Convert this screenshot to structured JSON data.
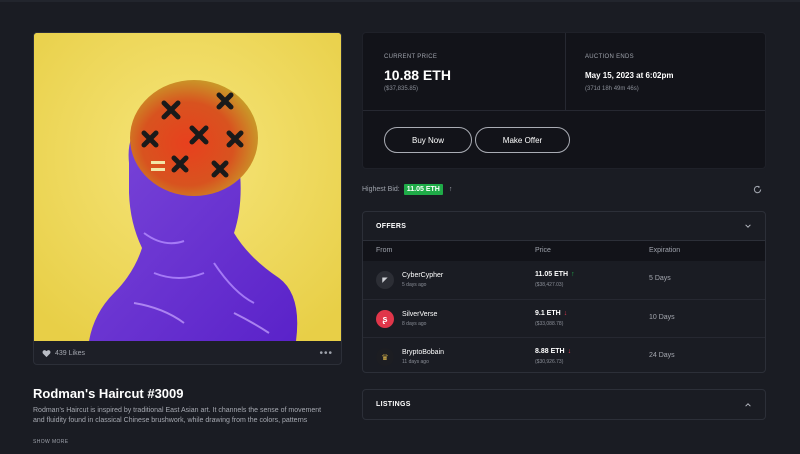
{
  "nft": {
    "likes": "439 Likes",
    "title": "Rodman's Haircut #3009",
    "description": "Rodman's Haircut is inspired by traditional East Asian art. It channels the sense of movement and fluidity found in classical Chinese brushwork, while drawing from the colors, patterns",
    "show_more": "SHOW MORE"
  },
  "price_panel": {
    "current_price_label": "CURRENT PRICE",
    "current_price": "10.88 ETH",
    "current_price_usd": "($37,835.85)",
    "auction_label": "AUCTION ENDS",
    "auction_date": "May 15, 2023 at 6:02pm",
    "auction_remaining": "(371d 18h 49m 46s)",
    "buy_label": "Buy Now",
    "offer_label": "Make Offer"
  },
  "highest_bid": {
    "label": "Highest Bid:",
    "value": "11.05 ETH",
    "arrow": "↑"
  },
  "offers": {
    "title": "OFFERS",
    "columns": [
      "From",
      "Price",
      "Expiration"
    ],
    "rows": [
      {
        "name": "CyberCypher",
        "time": "5 days ago",
        "price": "11.05 ETH",
        "arrow": "↑",
        "arrow_color": "#1fab48",
        "usd": "($38,427.03)",
        "expiration": "5 Days",
        "avatar_bg": "#2c2e35"
      },
      {
        "name": "SilverVerse",
        "time": "8 days ago",
        "price": "9.1 ETH",
        "arrow": "↓",
        "arrow_color": "#e0364a",
        "usd": "($33,088.78)",
        "expiration": "10 Days",
        "avatar_bg": "#e0364a"
      },
      {
        "name": "BryptoBobain",
        "time": "11 days ago",
        "price": "8.88 ETH",
        "arrow": "↓",
        "arrow_color": "#e0364a",
        "usd": "($30,926.73)",
        "expiration": "24 Days",
        "avatar_bg": "#1c1d22"
      }
    ]
  },
  "listings": {
    "title": "LISTINGS"
  },
  "colors": {
    "accent_green": "#1fab48",
    "accent_red": "#e0364a",
    "background": "#1a1c23",
    "panel": "#121319"
  },
  "icons": [
    "heart-icon",
    "more-icon",
    "refresh-icon",
    "chevron-down-icon",
    "chevron-up-icon"
  ]
}
